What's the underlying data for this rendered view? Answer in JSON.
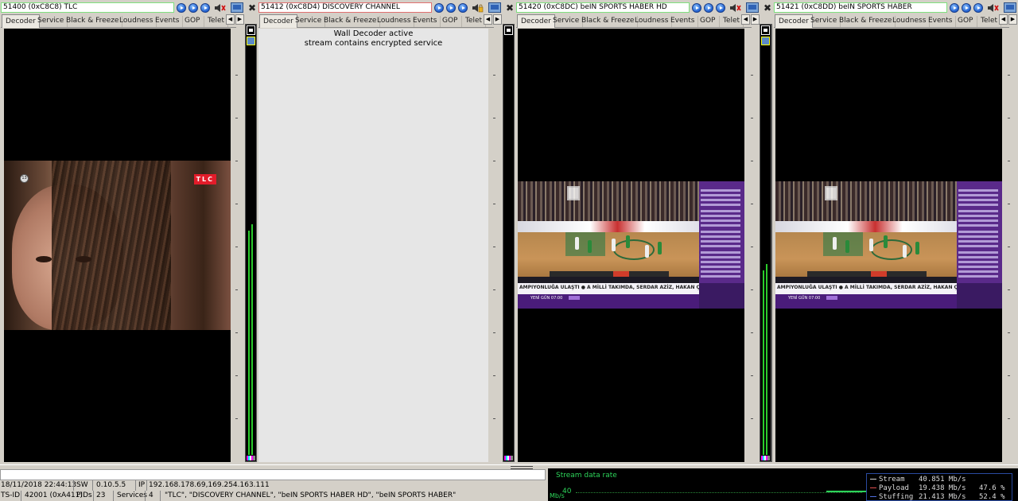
{
  "tabs": [
    "Decoder",
    "Service",
    "Black & Freeze",
    "Loudness",
    "Events",
    "GOP",
    "Telet"
  ],
  "panels": [
    {
      "title": "51400 (0xC8C8) TLC"
    },
    {
      "title": "51412 (0xC8D4) DISCOVERY CHANNEL",
      "message_line1": "Wall Decoder active",
      "message_line2": "stream contains encrypted service"
    },
    {
      "title": "51420 (0xC8DC) beIN SPORTS HABER HD"
    },
    {
      "title": "51421 (0xC8DD) beIN SPORTS HABER"
    }
  ],
  "video": {
    "tlc_logo": "TLC",
    "ticker": "AMPIYONLUĞA ULAŞTI  ●  A MİLLİ TAKIMDA, SERDAR AZİZ, HAKAN ÇALHANOĞLU VE HA",
    "lower": "YENİ GÜN   07:00"
  },
  "status": {
    "datetime": "18/11/2018 22:44:13",
    "sw_label": "SW",
    "sw_value": "0.10.5.5",
    "ip_label": "IP",
    "ip_value": "192.168.178.69,169.254.163.111",
    "tsid_label": "TS-ID",
    "tsid_value": "42001 (0xA411)",
    "pids_label": "PIDs",
    "pids_value": "23",
    "services_label": "Services",
    "services_value": "4",
    "services_list": "\"TLC\", \"DISCOVERY CHANNEL\", \"beIN SPORTS HABER HD\", \"beIN SPORTS HABER\""
  },
  "graph": {
    "title": "Stream data rate",
    "y_tick": "40",
    "axis_unit": "Mb/s",
    "legend": [
      {
        "name": "Stream",
        "value": "40.851 Mb/s",
        "pct": "",
        "color": "#d8d8d8"
      },
      {
        "name": "Payload",
        "value": "19.438 Mb/s",
        "pct": "47.6 %",
        "color": "#e05050"
      },
      {
        "name": "Stuffing",
        "value": "21.413 Mb/s",
        "pct": "52.4 %",
        "color": "#5070e0"
      }
    ]
  }
}
